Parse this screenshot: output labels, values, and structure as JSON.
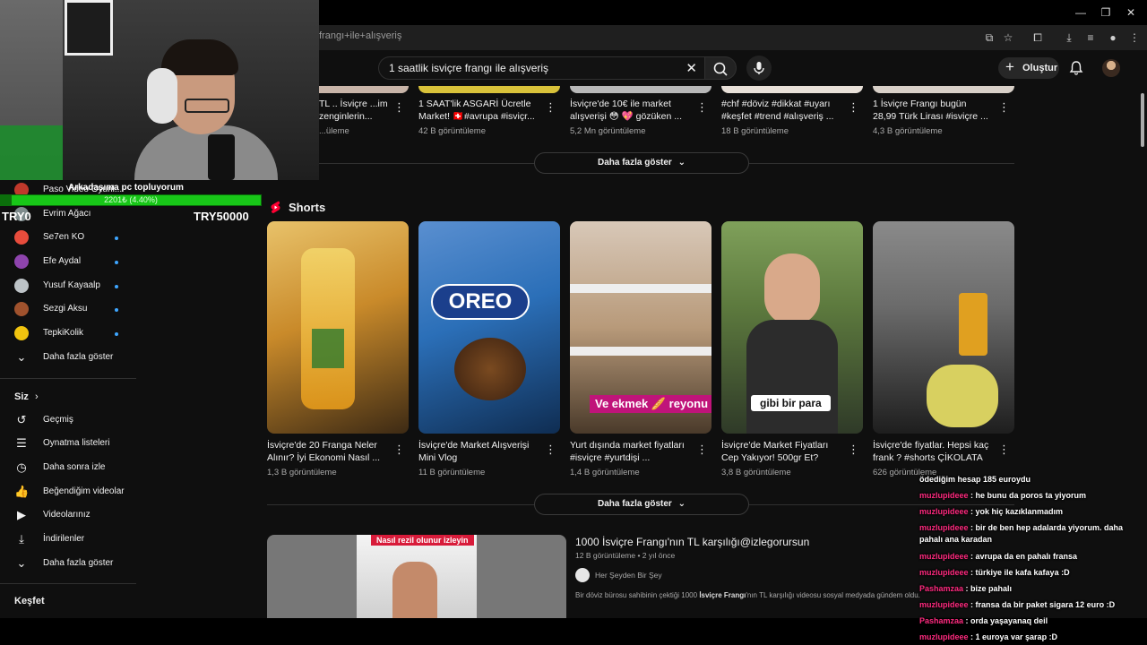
{
  "browser": {
    "url": "frangı+ile+alışveriş"
  },
  "search": {
    "query": "1 saatlik isviçre frangı ile alışveriş"
  },
  "header": {
    "create_label": "Oluştur"
  },
  "sidebar": {
    "subscriptions": [
      {
        "label": "Paso Video Oyunl...",
        "color": "#c0392b"
      },
      {
        "label": "Evrim Ağacı",
        "color": "#7f8c8d"
      },
      {
        "label": "Se7en KO",
        "color": "#e74c3c"
      },
      {
        "label": "Efe Aydal",
        "color": "#8e44ad"
      },
      {
        "label": "Yusuf Kayaalp",
        "color": "#bdc3c7"
      },
      {
        "label": "Sezgi Aksu",
        "color": "#a0522d"
      },
      {
        "label": "TepkiKolik",
        "color": "#f1c40f"
      }
    ],
    "show_more": "Daha fazla göster",
    "you_heading": "Siz",
    "you_items": [
      "Geçmiş",
      "Oynatma listeleri",
      "Daha sonra izle",
      "Beğendiğim videolar",
      "Videolarınız",
      "İndirilenler",
      "Daha fazla göster"
    ],
    "explore_heading": "Keşfet"
  },
  "top_row": [
    {
      "title": "TL .. İsviçre ...im zenginlerin...",
      "views": "...üleme"
    },
    {
      "title": "1 SAAT'lik ASGARİ Ücretle Market! 🇨🇭#avrupa #isviçr...",
      "views": "42 B görüntüleme"
    },
    {
      "title": "İsviçre'de 10€ ile market alışverişi 😳 💖 gözüken ...",
      "views": "5,2 Mn görüntüleme"
    },
    {
      "title": "#chf #döviz #dikkat #uyarı #keşfet #trend #alışveriş ...",
      "views": "18 B görüntüleme"
    },
    {
      "title": "1 İsviçre Frangı bugün 28,99 Türk Lirası #isviçre ...",
      "views": "4,3 B görüntüleme"
    }
  ],
  "more_button": "Daha fazla göster",
  "shorts": {
    "heading": "Shorts",
    "items": [
      {
        "title": "İsviçre'de 20 Franga Neler Alınır? İyi Ekonomi Nasıl ...",
        "views": "1,3 B görüntüleme",
        "overlay": "",
        "color1": "#c98a2a",
        "color2": "#3d2a14"
      },
      {
        "title": "İsviçre'de Market Alışverişi Mini Vlog",
        "views": "11 B görüntüleme",
        "overlay": "",
        "color1": "#2b6fb8",
        "color2": "#0f2d52"
      },
      {
        "title": "Yurt dışında market fiyatları #isviçre #yurtdişi ...",
        "views": "1,4 B görüntüleme",
        "overlay": "Ve ekmek 🥖 reyonu",
        "color1": "#b89a7a",
        "color2": "#4a3a2a"
      },
      {
        "title": "İsviçre'de Market Fiyatları Cep Yakıyor! 500gr Et? 10'...",
        "views": "3,8 B görüntüleme",
        "overlay": "gibi bir para",
        "color1": "#7fa05a",
        "color2": "#2f3a28"
      },
      {
        "title": "İsviçre'de fiyatlar. Hepsi kaç frank ? #shorts ÇİKOLATA",
        "views": "626 görüntüleme",
        "overlay": "",
        "color1": "#6b6b6b",
        "color2": "#1e1e1e"
      }
    ]
  },
  "long_video": {
    "title": "1000 İsviçre Frangı'nın TL karşılığı@izlegorursun",
    "meta": "12 B görüntüleme • 2 yıl önce",
    "channel": "Her Şeyden Bir Şey",
    "description_prefix": "Bir döviz bürosu sahibinin çektiği 1000 ",
    "description_bold": "İsviçre Frangı",
    "description_suffix": "'nın TL karşılığı videosu sosyal medyada gündem oldu.",
    "thumb_banner": "Nasıl rezil olunur izleyin"
  },
  "donation": {
    "title": "Arkadaşıma pc topluyorum",
    "progress_text": "2201₺ (4.40%)",
    "progress_fraction": 0.044,
    "left": "TRY0",
    "right": "TRY50000"
  },
  "chat": [
    {
      "user": "",
      "text": "ödediğim hesap 185 euroydu"
    },
    {
      "user": "muzlupideee",
      "text": ": he bunu da poros ta yiyorum"
    },
    {
      "user": "muzlupideee",
      "text": ": yok hiç kazıklanmadım"
    },
    {
      "user": "muzlupideee",
      "text": ": bir de ben hep adalarda yiyorum. daha pahalı ana karadan"
    },
    {
      "user": "muzlupideee",
      "text": ": avrupa da en pahalı fransa"
    },
    {
      "user": "muzlupideee",
      "text": ": türkiye ile kafa kafaya :D"
    },
    {
      "user": "Pashamzaa",
      "text": ": bize pahalı"
    },
    {
      "user": "muzlupideee",
      "text": ": fransa da bir paket sigara 12 euro :D"
    },
    {
      "user": "Pashamzaa",
      "text": ": orda yaşayanaq deil"
    },
    {
      "user": "muzlupideee",
      "text": ": 1 euroya var şarap :D"
    }
  ]
}
